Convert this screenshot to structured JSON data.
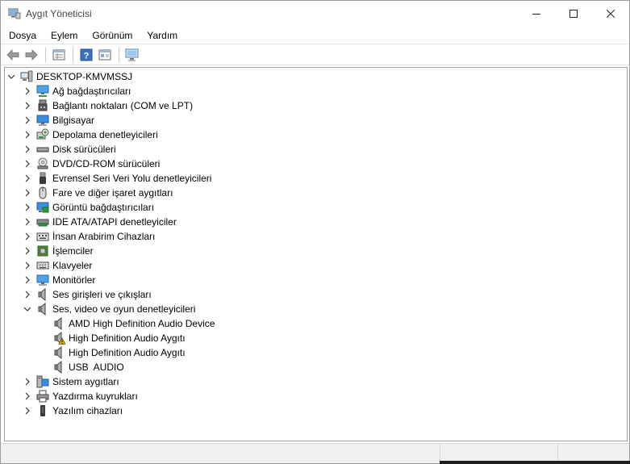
{
  "window": {
    "title": "Aygıt Yöneticisi"
  },
  "menu": [
    "Dosya",
    "Eylem",
    "Görünüm",
    "Yardım"
  ],
  "toolbar": [
    "back-arrow-icon",
    "forward-arrow-icon",
    "properties-icon",
    "help-icon",
    "update-driver-icon",
    "monitor-scan-icon"
  ],
  "tree": {
    "root": "DESKTOP-KMVMSSJ",
    "categories": [
      {
        "label": "Ağ bağdaştırıcıları",
        "icon": "network-adapter-icon",
        "expanded": false
      },
      {
        "label": "Bağlantı noktaları (COM ve LPT)",
        "icon": "port-icon",
        "expanded": false
      },
      {
        "label": "Bilgisayar",
        "icon": "computer-icon",
        "expanded": false
      },
      {
        "label": "Depolama denetleyicileri",
        "icon": "storage-controller-icon",
        "expanded": false
      },
      {
        "label": "Disk sürücüleri",
        "icon": "disk-drive-icon",
        "expanded": false
      },
      {
        "label": "DVD/CD-ROM sürücüleri",
        "icon": "dvd-icon",
        "expanded": false
      },
      {
        "label": "Evrensel Seri Veri Yolu denetleyicileri",
        "icon": "usb-icon",
        "expanded": false
      },
      {
        "label": "Fare ve diğer işaret aygıtları",
        "icon": "mouse-icon",
        "expanded": false
      },
      {
        "label": "Görüntü bağdaştırıcıları",
        "icon": "display-adapter-icon",
        "expanded": false
      },
      {
        "label": "IDE ATA/ATAPI denetleyiciler",
        "icon": "ide-controller-icon",
        "expanded": false
      },
      {
        "label": "İnsan Arabirim Cihazları",
        "icon": "hid-icon",
        "expanded": false
      },
      {
        "label": "İşlemciler",
        "icon": "processor-icon",
        "expanded": false
      },
      {
        "label": "Klavyeler",
        "icon": "keyboard-icon",
        "expanded": false
      },
      {
        "label": "Monitörler",
        "icon": "monitor-icon",
        "expanded": false
      },
      {
        "label": "Ses girişleri ve çıkışları",
        "icon": "speaker-icon",
        "expanded": false
      },
      {
        "label": "Ses, video ve oyun denetleyicileri",
        "icon": "speaker-icon",
        "expanded": true,
        "children": [
          {
            "label": "AMD High Definition Audio Device",
            "icon": "speaker-icon"
          },
          {
            "label": "High Definition Audio Aygıtı",
            "icon": "warning-speaker-icon"
          },
          {
            "label": "High Definition Audio Aygıtı",
            "icon": "speaker-icon"
          },
          {
            "label": "USB  AUDIO",
            "icon": "speaker-icon"
          }
        ]
      },
      {
        "label": "Sistem aygıtları",
        "icon": "system-device-icon",
        "expanded": false
      },
      {
        "label": "Yazdırma kuyrukları",
        "icon": "printer-icon",
        "expanded": false
      },
      {
        "label": "Yazılım cihazları",
        "icon": "software-device-icon",
        "expanded": false
      }
    ]
  },
  "colors": {
    "accent_blue": "#2b7bd3",
    "warning_yellow": "#f2c200"
  }
}
